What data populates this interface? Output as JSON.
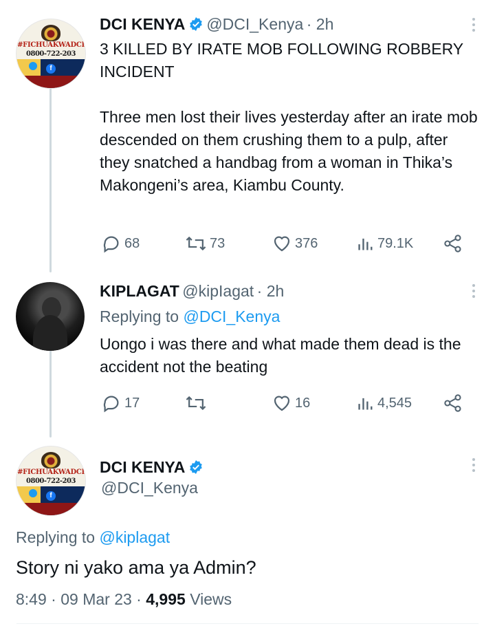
{
  "tweet1": {
    "display_name": "DCI KENYA",
    "handle": "@DCI_Kenya",
    "time": "· 2h",
    "headline": "3 KILLED BY IRATE MOB FOLLOWING ROBBERY INCIDENT",
    "body": "Three men lost their lives yesterday after an irate mob descended on them crushing them to a pulp, after they snatched a handbag from a woman in Thika’s Makongeni’s area, Kiambu County.",
    "replies": "68",
    "retweets": "73",
    "likes": "376",
    "views": "79.1K"
  },
  "tweet2": {
    "display_name": "KIPLAGAT",
    "handle": "@kipIagat",
    "time": "· 2h",
    "replying_label": "Replying to",
    "replying_to": "@DCI_Kenya",
    "body": "Uongo i was there and what made them dead is the accident not the beating",
    "replies": "17",
    "retweets": "",
    "likes": "16",
    "views": "4,545"
  },
  "tweet3": {
    "display_name": "DCI KENYA",
    "handle": "@DCI_Kenya",
    "replying_label": "Replying to",
    "replying_to": "@kiplagat",
    "body": "Story ni yako ama ya Admin?",
    "time": "8:49",
    "date": "09 Mar 23",
    "views_count": "4,995",
    "views_label": "Views"
  },
  "avatar_dci": {
    "tag": "#FICHUAKWADCI",
    "phone": "0800-722-203",
    "fb": "f"
  },
  "colors": {
    "verified": "#1d9bf0",
    "link": "#1d9bf0",
    "muted": "#536471"
  }
}
